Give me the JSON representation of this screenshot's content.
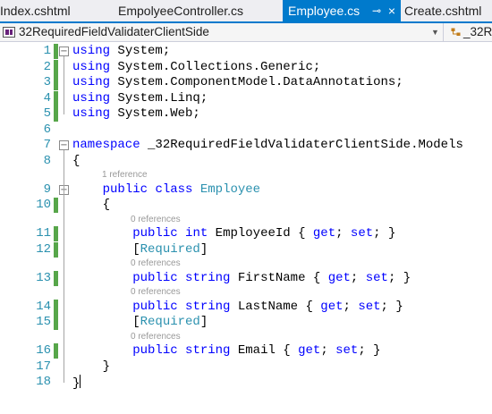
{
  "tabs": [
    {
      "label": "Index.cshtml",
      "active": false
    },
    {
      "label": "EmpolyeeController.cs",
      "active": false
    },
    {
      "label": "Employee.cs",
      "active": true,
      "pin": "⊸",
      "close": "×"
    },
    {
      "label": "Create.cshtml",
      "active": false
    }
  ],
  "navbar": {
    "project_icon": "csharp-project-icon",
    "project": "32RequiredFieldValidaterClientSide",
    "dropdown_icon": "chevron-down-icon",
    "dropdown_glyph": "▼",
    "class_icon": "class-icon",
    "class_name": "_32Re"
  },
  "colors": {
    "keyword": "#0000ff",
    "type": "#2b91af",
    "line_number": "#2b91af",
    "change_bar": "#57a64a",
    "codelens": "#999999",
    "active_tab": "#007acc"
  },
  "fold_glyphs": {
    "collapse": "−"
  },
  "code_lens": [
    {
      "text": "1 reference"
    },
    {
      "text": "0 references"
    },
    {
      "text": "0 references"
    },
    {
      "text": "0 references"
    },
    {
      "text": "0 references"
    }
  ],
  "lines": [
    {
      "num": "1",
      "tokens": [
        {
          "c": "kw",
          "t": "using"
        },
        {
          "c": "tx",
          "t": " System;"
        }
      ]
    },
    {
      "num": "2",
      "tokens": [
        {
          "c": "kw",
          "t": "using"
        },
        {
          "c": "tx",
          "t": " System.Collections.Generic;"
        }
      ]
    },
    {
      "num": "3",
      "tokens": [
        {
          "c": "kw",
          "t": "using"
        },
        {
          "c": "tx",
          "t": " System.ComponentModel.DataAnnotations;"
        }
      ]
    },
    {
      "num": "4",
      "tokens": [
        {
          "c": "kw",
          "t": "using"
        },
        {
          "c": "tx",
          "t": " System.Linq;"
        }
      ]
    },
    {
      "num": "5",
      "tokens": [
        {
          "c": "kw",
          "t": "using"
        },
        {
          "c": "tx",
          "t": " System.Web;"
        }
      ]
    },
    {
      "num": "6",
      "tokens": []
    },
    {
      "num": "7",
      "tokens": [
        {
          "c": "kw",
          "t": "namespace"
        },
        {
          "c": "tx",
          "t": " _32RequiredFieldValidaterClientSide.Models"
        }
      ]
    },
    {
      "num": "8",
      "tokens": [
        {
          "c": "tx",
          "t": "{"
        }
      ]
    },
    {
      "num": "9",
      "tokens": [
        {
          "c": "tx",
          "t": "    "
        },
        {
          "c": "kw",
          "t": "public"
        },
        {
          "c": "tx",
          "t": " "
        },
        {
          "c": "kw",
          "t": "class"
        },
        {
          "c": "tx",
          "t": " "
        },
        {
          "c": "ty",
          "t": "Employee"
        }
      ]
    },
    {
      "num": "10",
      "tokens": [
        {
          "c": "tx",
          "t": "    {"
        }
      ]
    },
    {
      "num": "11",
      "tokens": [
        {
          "c": "tx",
          "t": "        "
        },
        {
          "c": "kw",
          "t": "public"
        },
        {
          "c": "tx",
          "t": " "
        },
        {
          "c": "kw",
          "t": "int"
        },
        {
          "c": "tx",
          "t": " EmployeeId { "
        },
        {
          "c": "kw",
          "t": "get"
        },
        {
          "c": "tx",
          "t": "; "
        },
        {
          "c": "kw",
          "t": "set"
        },
        {
          "c": "tx",
          "t": "; }"
        }
      ]
    },
    {
      "num": "12",
      "tokens": [
        {
          "c": "tx",
          "t": "        ["
        },
        {
          "c": "ty",
          "t": "Required"
        },
        {
          "c": "tx",
          "t": "]"
        }
      ]
    },
    {
      "num": "13",
      "tokens": [
        {
          "c": "tx",
          "t": "        "
        },
        {
          "c": "kw",
          "t": "public"
        },
        {
          "c": "tx",
          "t": " "
        },
        {
          "c": "kw",
          "t": "string"
        },
        {
          "c": "tx",
          "t": " FirstName { "
        },
        {
          "c": "kw",
          "t": "get"
        },
        {
          "c": "tx",
          "t": "; "
        },
        {
          "c": "kw",
          "t": "set"
        },
        {
          "c": "tx",
          "t": "; }"
        }
      ]
    },
    {
      "num": "14",
      "tokens": [
        {
          "c": "tx",
          "t": "        "
        },
        {
          "c": "kw",
          "t": "public"
        },
        {
          "c": "tx",
          "t": " "
        },
        {
          "c": "kw",
          "t": "string"
        },
        {
          "c": "tx",
          "t": " LastName { "
        },
        {
          "c": "kw",
          "t": "get"
        },
        {
          "c": "tx",
          "t": "; "
        },
        {
          "c": "kw",
          "t": "set"
        },
        {
          "c": "tx",
          "t": "; }"
        }
      ]
    },
    {
      "num": "15",
      "tokens": [
        {
          "c": "tx",
          "t": "        ["
        },
        {
          "c": "ty",
          "t": "Required"
        },
        {
          "c": "tx",
          "t": "]"
        }
      ]
    },
    {
      "num": "16",
      "tokens": [
        {
          "c": "tx",
          "t": "        "
        },
        {
          "c": "kw",
          "t": "public"
        },
        {
          "c": "tx",
          "t": " "
        },
        {
          "c": "kw",
          "t": "string"
        },
        {
          "c": "tx",
          "t": " Email { "
        },
        {
          "c": "kw",
          "t": "get"
        },
        {
          "c": "tx",
          "t": "; "
        },
        {
          "c": "kw",
          "t": "set"
        },
        {
          "c": "tx",
          "t": "; }"
        }
      ]
    },
    {
      "num": "17",
      "tokens": [
        {
          "c": "tx",
          "t": "    }"
        }
      ]
    },
    {
      "num": "18",
      "tokens": [
        {
          "c": "tx",
          "t": "}"
        }
      ]
    }
  ]
}
